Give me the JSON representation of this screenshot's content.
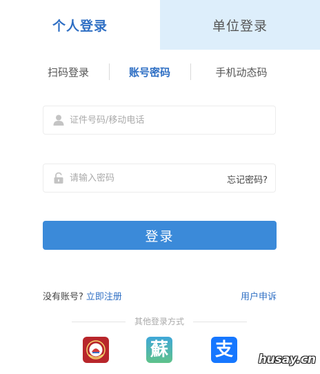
{
  "top_tabs": [
    {
      "label": "个人登录",
      "active": true
    },
    {
      "label": "单位登录",
      "active": false
    }
  ],
  "sub_tabs": [
    {
      "label": "扫码登录",
      "active": false
    },
    {
      "label": "账号密码",
      "active": true
    },
    {
      "label": "手机动态码",
      "active": false
    }
  ],
  "form": {
    "account_placeholder": "证件号码/移动电话",
    "account_icon": "user-icon",
    "password_placeholder": "请输入密码",
    "password_icon": "lock-icon",
    "forgot_label": "忘记密码?",
    "login_label": "登录"
  },
  "links": {
    "no_account_text": "没有账号?",
    "register_label": "立即注册",
    "appeal_label": "用户申诉"
  },
  "other_login": {
    "label": "其他登录方式",
    "apps": [
      {
        "icon": "emblem-app-icon",
        "color": "#b8262b"
      },
      {
        "icon": "su-app-icon",
        "glyph": "蘇",
        "color": "#3fa7d8"
      },
      {
        "icon": "alipay-icon",
        "glyph": "支",
        "color": "#1677ff"
      }
    ]
  },
  "colors": {
    "accent": "#2f6fc4",
    "button": "#3b8ad9",
    "inactive_tab_bg": "#ddeefb"
  },
  "watermark": "husay.cn"
}
